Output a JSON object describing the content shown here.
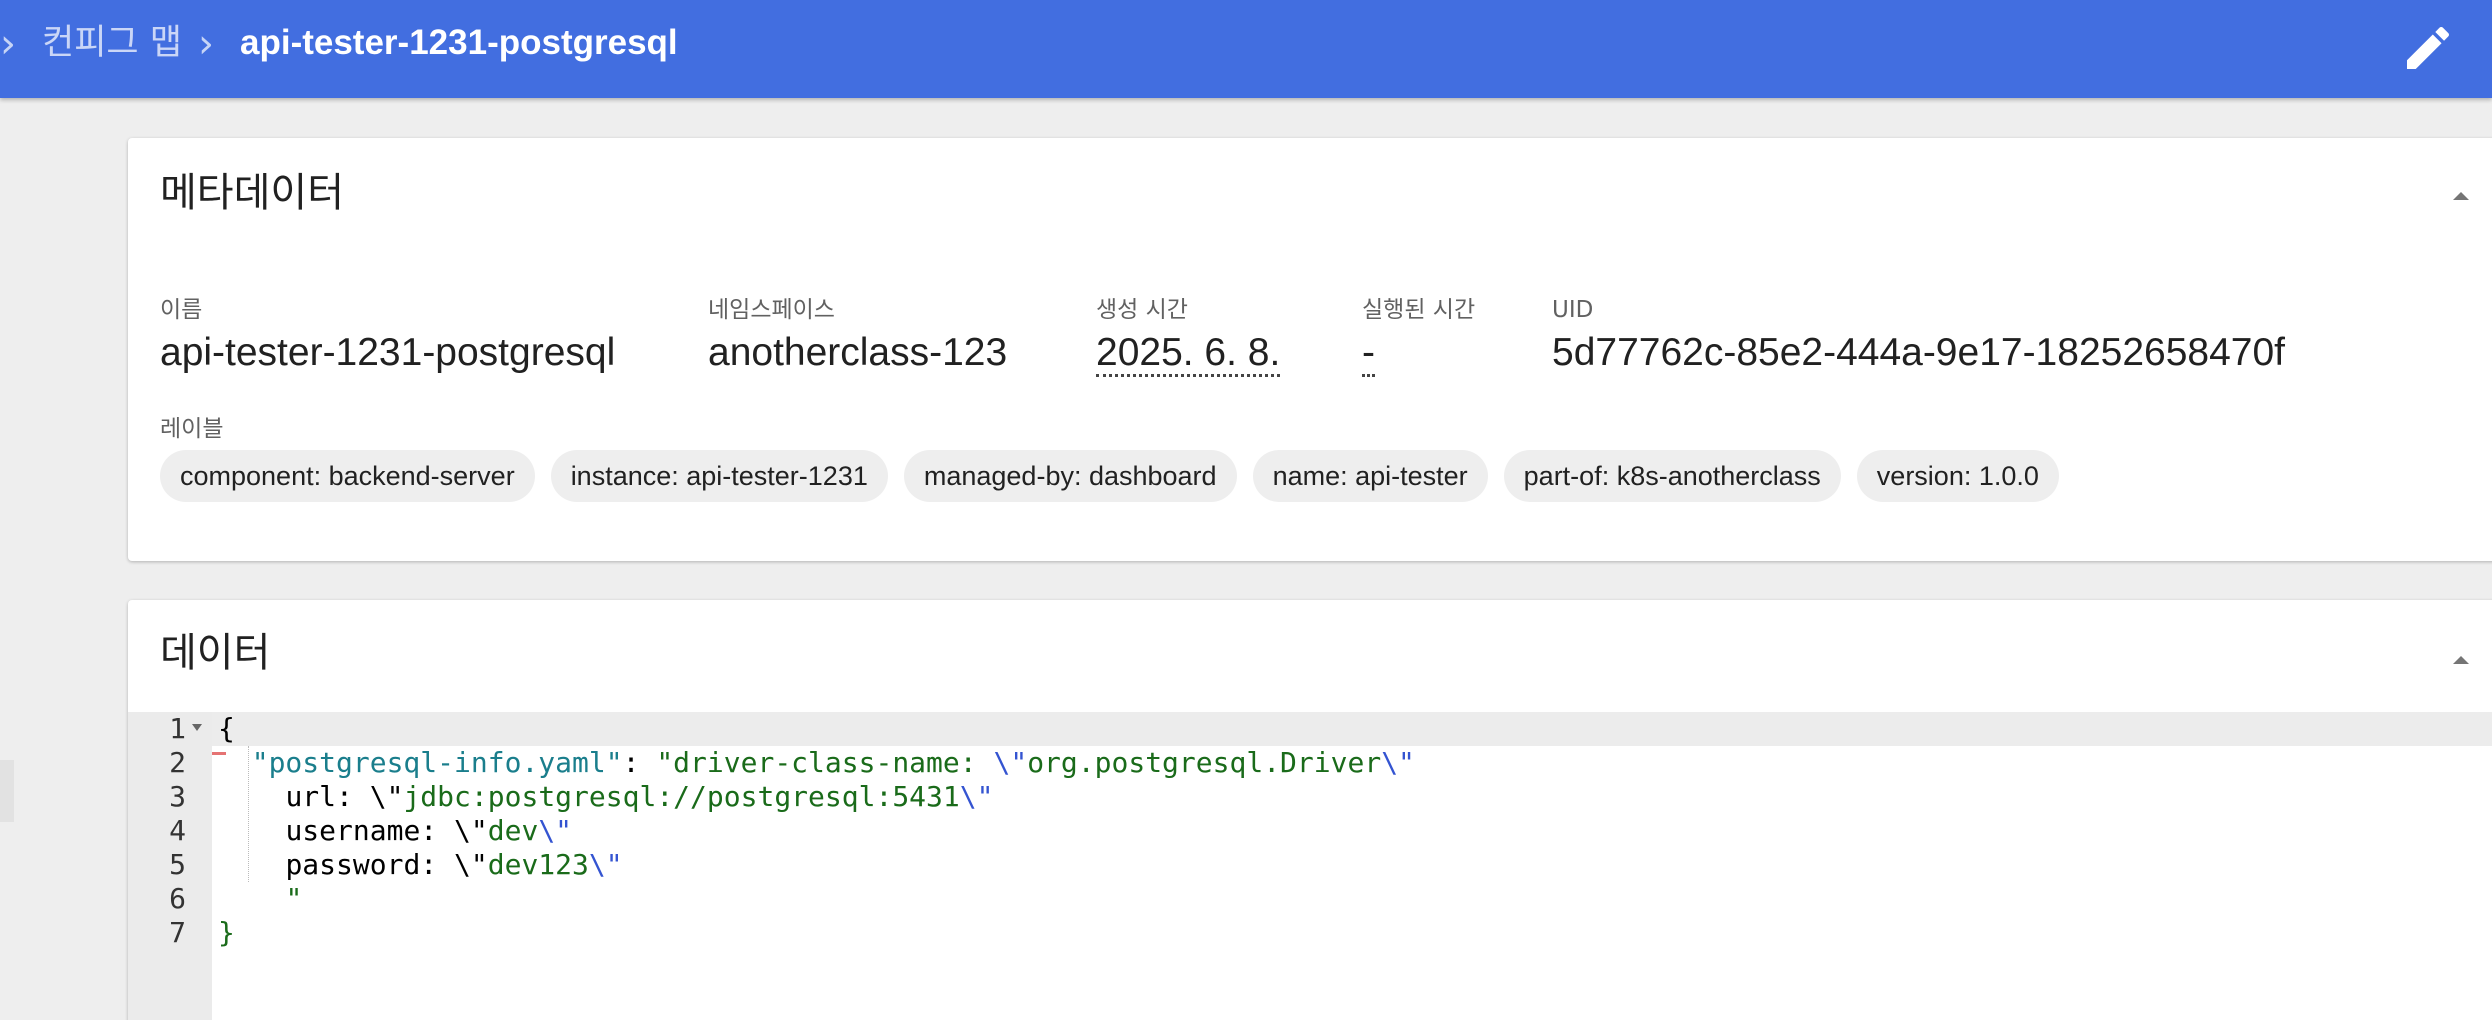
{
  "breadcrumb": {
    "parent": "컨피그 맵",
    "current": "api-tester-1231-postgresql"
  },
  "icons": {
    "edit": "edit-pencil-icon",
    "collapse": "collapse-caret-icon",
    "chevron": "chevron-right-icon"
  },
  "metadata": {
    "title": "메타데이터",
    "fields": {
      "name": {
        "label": "이름",
        "value": "api-tester-1231-postgresql"
      },
      "namespace": {
        "label": "네임스페이스",
        "value": "anotherclass-123"
      },
      "created": {
        "label": "생성 시간",
        "value": "2025. 6. 8."
      },
      "age": {
        "label": "실행된 시간",
        "value": "-"
      },
      "uid": {
        "label": "UID",
        "value": "5d77762c-85e2-444a-9e17-18252658470f"
      }
    },
    "labels_title": "레이블",
    "labels": [
      "component: backend-server",
      "instance: api-tester-1231",
      "managed-by: dashboard",
      "name: api-tester",
      "part-of: k8s-anotherclass",
      "version: 1.0.0"
    ]
  },
  "data_section": {
    "title": "데이터",
    "line_numbers": [
      "1",
      "2",
      "3",
      "4",
      "5",
      "6",
      "7"
    ],
    "code": {
      "l1": "{",
      "l2_key": "\"postgresql-info.yaml\"",
      "l2_colon": ": ",
      "l2_str_a": "\"driver-class-name: ",
      "l2_esc_a": "\\\"",
      "l2_str_b": "org.postgresql.Driver",
      "l2_esc_b": "\\\"",
      "l3_plain": "url: \\\"",
      "l3_str": "jdbc:postgresql://postgresql:5431",
      "l3_esc": "\\\"",
      "l4_plain": "username: \\\"",
      "l4_str": "dev",
      "l4_esc": "\\\"",
      "l5_plain": "password: \\\"",
      "l5_str": "dev123",
      "l5_esc": "\\\"",
      "l6": "\"",
      "l7": "}"
    }
  },
  "colors": {
    "topbar": "#426ee0",
    "json_key": "#1a7e8c",
    "json_string": "#1a6b1a",
    "json_escape": "#3454d1"
  }
}
